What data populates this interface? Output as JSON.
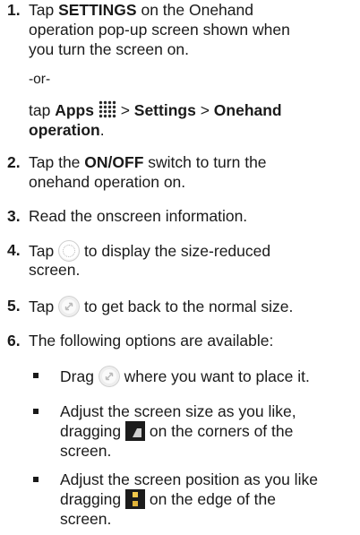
{
  "steps": [
    {
      "n": "1.",
      "a": "Tap ",
      "b": "SETTINGS",
      "c": " on the Onehand",
      "l2": "operation pop-up screen shown when",
      "l3": "you turn the screen on."
    },
    {
      "n": "2.",
      "a": "Tap the ",
      "b": "ON/OFF",
      "c": " switch to turn the",
      "l2": "onehand operation on."
    },
    {
      "n": "3.",
      "text": "Read the onscreen information."
    },
    {
      "n": "4.",
      "a": "Tap ",
      "c": " to display the size-reduced",
      "l2": "screen."
    },
    {
      "n": "5.",
      "a": "Tap ",
      "c": " to get back to the normal size."
    },
    {
      "n": "6.",
      "text": "The following options are available:"
    }
  ],
  "alt": {
    "or": "-or-",
    "a": "tap ",
    "apps": "Apps",
    "sep1": " > ",
    "settings": "Settings",
    "sep2": " > ",
    "onehand": "Onehand",
    "operation": "operation",
    "period": "."
  },
  "bullets": [
    {
      "a": "Drag ",
      "c": " where you want to place it."
    },
    {
      "l1": "Adjust the screen size as you like,",
      "a": "dragging ",
      "c": " on the corners of the",
      "l3": "screen."
    },
    {
      "l1": "Adjust the screen position as you like",
      "a": "dragging ",
      "c": " on the edge of the",
      "l3": "screen."
    }
  ],
  "icons": {
    "apps": "apps-grid-icon",
    "reduce": "size-reduce-circle-icon",
    "expand": "expand-arrows-icon",
    "corner": "corner-drag-handle-icon",
    "edge": "edge-drag-handle-icon"
  }
}
